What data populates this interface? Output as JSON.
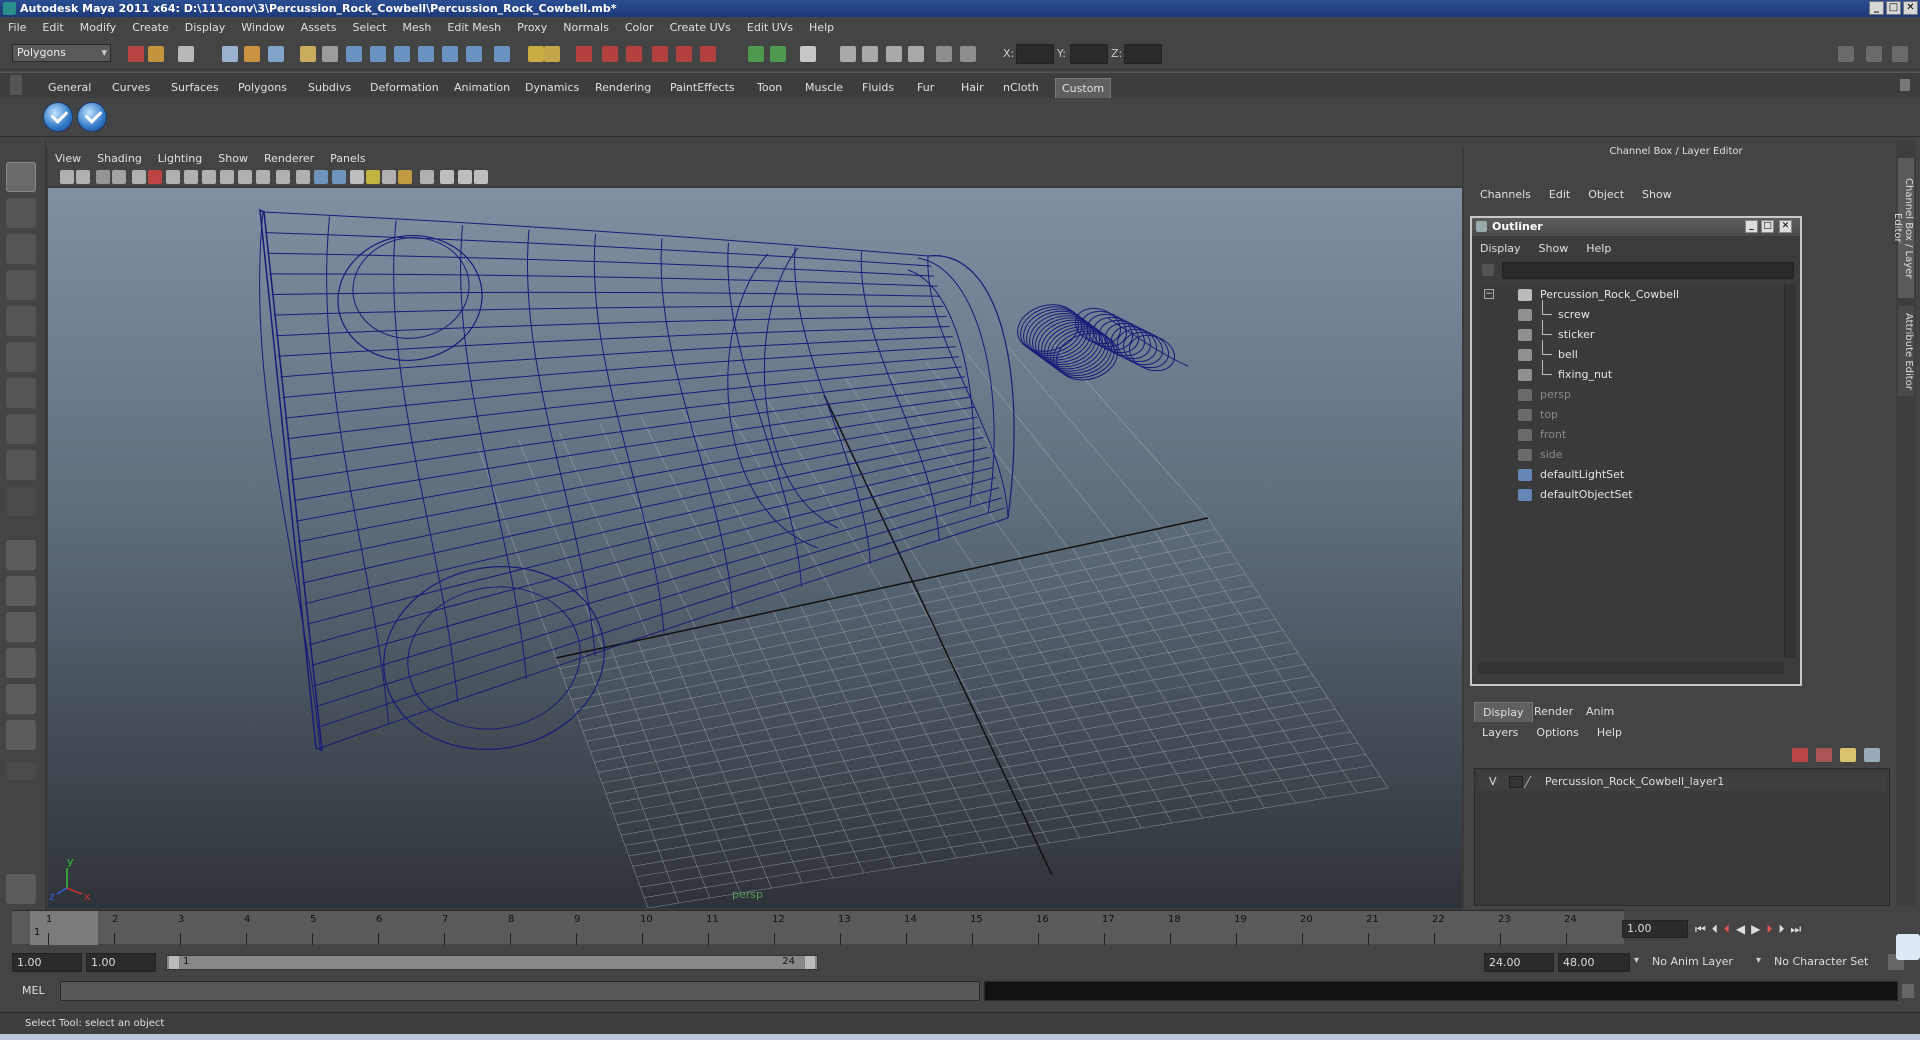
{
  "window": {
    "title": "Autodesk Maya 2011 x64: D:\\111conv\\3\\Percussion_Rock_Cowbell\\Percussion_Rock_Cowbell.mb*"
  },
  "menubar": [
    "File",
    "Edit",
    "Modify",
    "Create",
    "Display",
    "Window",
    "Assets",
    "Select",
    "Mesh",
    "Edit Mesh",
    "Proxy",
    "Normals",
    "Color",
    "Create UVs",
    "Edit UVs",
    "Help"
  ],
  "toolbar": {
    "menu_set": "Polygons",
    "x_label": "X:",
    "y_label": "Y:",
    "z_label": "Z:"
  },
  "shelf": {
    "tabs": [
      "General",
      "Curves",
      "Surfaces",
      "Polygons",
      "Subdivs",
      "Deformation",
      "Animation",
      "Dynamics",
      "Rendering",
      "PaintEffects",
      "Toon",
      "Muscle",
      "Fluids",
      "Fur",
      "Hair",
      "nCloth",
      "Custom"
    ],
    "active_tab": "Custom"
  },
  "viewport": {
    "menu": [
      "View",
      "Shading",
      "Lighting",
      "Show",
      "Renderer",
      "Panels"
    ],
    "camera": "persp",
    "axis_y": "y",
    "axis_z": "z",
    "axis_x": "x",
    "wire_color": "#1a1a7a"
  },
  "channel_box": {
    "title": "Channel Box / Layer Editor",
    "menu": [
      "Channels",
      "Edit",
      "Object",
      "Show"
    ]
  },
  "side_tabs": [
    "Channel Box / Layer Editor",
    "Attribute Editor"
  ],
  "outliner": {
    "title": "Outliner",
    "menu": [
      "Display",
      "Show",
      "Help"
    ],
    "items": [
      {
        "label": "Percussion_Rock_Cowbell",
        "level": 0,
        "dim": false
      },
      {
        "label": "screw",
        "level": 1,
        "dim": false
      },
      {
        "label": "sticker",
        "level": 1,
        "dim": false
      },
      {
        "label": "bell",
        "level": 1,
        "dim": false
      },
      {
        "label": "fixing_nut",
        "level": 1,
        "dim": false
      },
      {
        "label": "persp",
        "level": 0,
        "dim": true
      },
      {
        "label": "top",
        "level": 0,
        "dim": true
      },
      {
        "label": "front",
        "level": 0,
        "dim": true
      },
      {
        "label": "side",
        "level": 0,
        "dim": true
      },
      {
        "label": "defaultLightSet",
        "level": 0,
        "dim": false
      },
      {
        "label": "defaultObjectSet",
        "level": 0,
        "dim": false
      }
    ]
  },
  "layer_editor": {
    "tabs": [
      "Display",
      "Render",
      "Anim"
    ],
    "active_tab": "Display",
    "menu": [
      "Layers",
      "Options",
      "Help"
    ],
    "layer_visible": "V",
    "layer_name": "Percussion_Rock_Cowbell_layer1"
  },
  "timeline": {
    "frames": [
      "1",
      "2",
      "3",
      "4",
      "5",
      "6",
      "7",
      "8",
      "9",
      "10",
      "11",
      "12",
      "13",
      "14",
      "15",
      "16",
      "17",
      "18",
      "19",
      "20",
      "21",
      "22",
      "23",
      "24"
    ],
    "current_frame": "1.00",
    "start_marker": "1"
  },
  "range": {
    "start": "1.00",
    "playback_start": "1.00",
    "slider_start": "1",
    "slider_end": "24",
    "playback_end": "24.00",
    "end": "48.00",
    "anim_layer": "No Anim Layer",
    "character_set": "No Character Set"
  },
  "command_line": {
    "label": "MEL"
  },
  "help_line": "Select Tool: select an object"
}
